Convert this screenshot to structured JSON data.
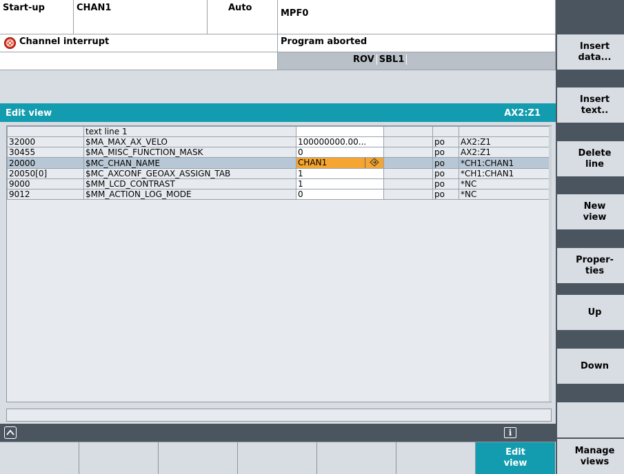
{
  "header": {
    "mode": "Start-up",
    "channel": "CHAN1",
    "op_mode": "Auto",
    "program": "MPF0",
    "alarm_text": "Channel interrupt",
    "program_status": "Program aborted",
    "flags": [
      "ROV",
      "SBL1"
    ]
  },
  "view": {
    "title": "Edit view",
    "axis_ref": "AX2:Z1"
  },
  "table": {
    "rows": [
      {
        "num": "",
        "name": "text line 1",
        "value": "",
        "unit": "",
        "po": "",
        "ref": ""
      },
      {
        "num": "32000",
        "name": "$MA_MAX_AX_VELO",
        "value": "100000000.00...",
        "unit": "",
        "po": "po",
        "ref": "AX2:Z1"
      },
      {
        "num": "30455",
        "name": "$MA_MISC_FUNCTION_MASK",
        "value": "0",
        "unit": "",
        "po": "po",
        "ref": "AX2:Z1"
      },
      {
        "num": "20000",
        "name": "$MC_CHAN_NAME",
        "value": "CHAN1",
        "unit": "",
        "po": "po",
        "ref": "*CH1:CHAN1"
      },
      {
        "num": "20050[0]",
        "name": "$MC_AXCONF_GEOAX_ASSIGN_TAB",
        "value": "1",
        "unit": "",
        "po": "po",
        "ref": "*CH1:CHAN1"
      },
      {
        "num": "9000",
        "name": "$MM_LCD_CONTRAST",
        "value": "1",
        "unit": "",
        "po": "po",
        "ref": "*NC"
      },
      {
        "num": "9012",
        "name": "$MM_ACTION_LOG_MODE",
        "value": "0",
        "unit": "",
        "po": "po",
        "ref": "*NC"
      }
    ],
    "selected_row": 3
  },
  "icons": {
    "alarm": "alarm-stop-icon",
    "recall": "recall-icon",
    "info": "info-icon",
    "info_glyph": "i",
    "edit_toggle": "edit-toggle-icon"
  },
  "vkeys": [
    {
      "label": "Insert data..."
    },
    {
      "label": "Insert text.."
    },
    {
      "label": "Delete line"
    },
    {
      "label": "New view"
    },
    {
      "label": "Proper- ties"
    },
    {
      "label": "Up"
    },
    {
      "label": "Down"
    },
    {
      "label": ""
    },
    {
      "label": "Manage views"
    }
  ],
  "hkeys": [
    {
      "label": ""
    },
    {
      "label": ""
    },
    {
      "label": ""
    },
    {
      "label": ""
    },
    {
      "label": ""
    },
    {
      "label": ""
    },
    {
      "label": "Edit view"
    }
  ],
  "colors": {
    "accent": "#139caf",
    "selection": "#f5a531",
    "panel": "#d8dde3",
    "dark": "#4b5560",
    "alarm": "#d9331b"
  }
}
